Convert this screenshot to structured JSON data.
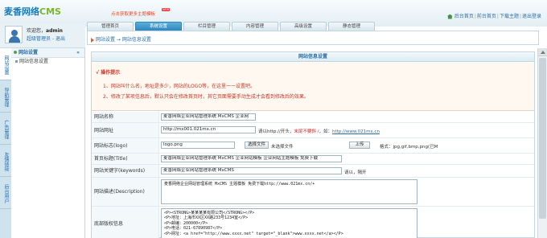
{
  "header": {
    "logo_main": "麦香网络",
    "logo_cms": "CMS",
    "promo": "点击获取更多主题模板",
    "promo_badge": "NEW",
    "links": [
      "后台首页",
      "前台首页",
      "下载主题",
      "退出登录"
    ]
  },
  "tabs": [
    "管理首页",
    "系统设置",
    "栏目管理",
    "内容管理",
    "高级设置",
    "静态管理"
  ],
  "active_tab": "系统设置",
  "user": {
    "welcome": "欢迎您，",
    "name": "admin",
    "role": "超级管理员 - 退出"
  },
  "breadcrumb": "网站设置 → 网站信息设置",
  "vertical_tabs": [
    "网站设置",
    "导航管理",
    "广告管理",
    "友情链接",
    "后台用户"
  ],
  "sidebar": {
    "heading": "网站设置",
    "collapse": "«",
    "items": [
      "网站信息设置"
    ]
  },
  "main": {
    "title": "网站信息设置",
    "tips_title": "√ 操作提示",
    "tips": [
      "1、网站叫什么名，地址是多少，网站的LOGO等，在这里一一设置吧。",
      "2、修改了某项信息后，默认只会在修改首页时，其它页面需要手动生成才会看到修改后的效果。"
    ],
    "fields": {
      "site_name": {
        "label": "网站名称",
        "value": "麦香网络企业网站管理系统 MxCMS 企业网"
      },
      "site_url": {
        "label": "网站网址",
        "value": "http://mx001.021mx.cn",
        "hint_pre": "请以http://开头，",
        "hint_red": "末尾不要斜 /",
        "hint_post": "，如：",
        "hint_link": "http://www.021mx.cn"
      },
      "logo": {
        "label": "网站标志(logo)",
        "value": "logo.png",
        "choose_btn": "选择文件",
        "no_file": "未选择文件",
        "upload_btn": "上传",
        "format": "格式：jpg,gif,bmp,png(已M"
      },
      "home_title": {
        "label": "首页标题(Title)",
        "value": "麦香网络企业网站管理系统 MxCMS 企业网站模板 企业网站主题模板 免费下载"
      },
      "keywords": {
        "label": "网站关键字(keywords)",
        "value": "麦香网络企业网站管理系统 MxCMS",
        "hint": "请以，隔开"
      },
      "description": {
        "label": "网站描述(Description)",
        "value": "麦香网络企业网站管理系统 MxCMS 主题模板 免费下载http://www.021mx.cn/+"
      },
      "footer": {
        "label": "底部版权信息",
        "lines": [
          "<P><STRONG>某某某某有限公司</STRONG></P>",
          "<P>地址：上海市XX区XX路233号1234室</P>",
          "<P>邮编：200000</P>",
          "<P>电话：021-67890987</P>",
          "<P>网址：<a href=\"http://www.xxxx.net\" target=\"_blank\">www.xxxx.net</a></P>"
        ]
      }
    }
  }
}
